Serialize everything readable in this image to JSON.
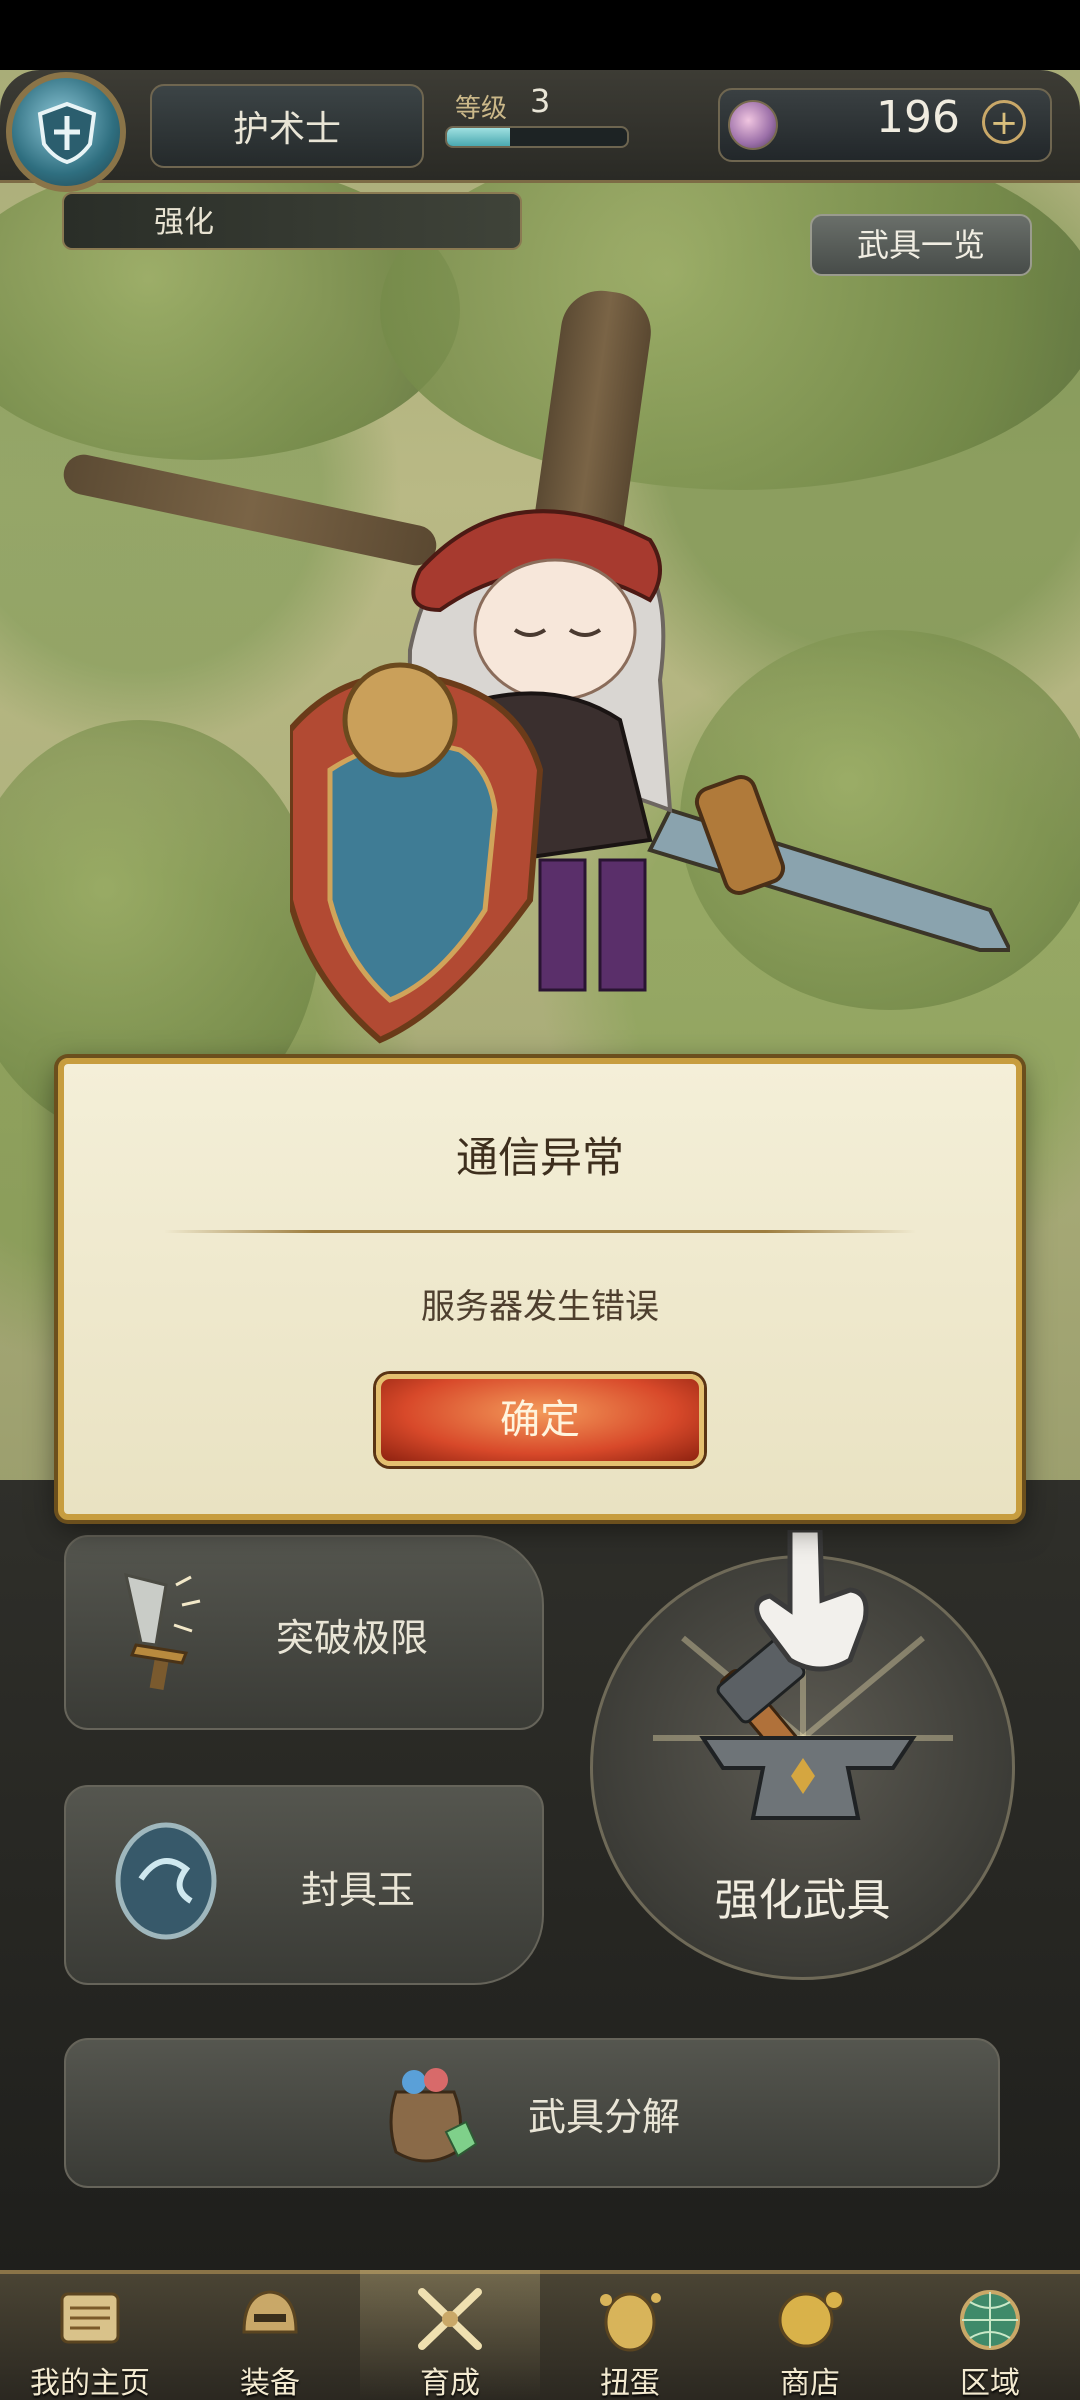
{
  "header": {
    "job_name": "护术士",
    "level_label": "等级",
    "level_value": "3",
    "level_progress": 0.35,
    "gem_count": "196",
    "plus_symbol": "+"
  },
  "sub_header": {
    "section": "强化",
    "weapon_list_label": "武具一览"
  },
  "dialog": {
    "title": "通信异常",
    "message": "服务器发生错误",
    "confirm_label": "确定"
  },
  "actions": {
    "limit_break": "突破极限",
    "seal_gem": "封具玉",
    "enhance_weapon": "强化武具",
    "dismantle": "武具分解"
  },
  "nav": {
    "items": [
      {
        "label": "我的主页",
        "icon": "scroll-icon"
      },
      {
        "label": "装备",
        "icon": "helmet-icon"
      },
      {
        "label": "育成",
        "icon": "crossed-swords-icon"
      },
      {
        "label": "扭蛋",
        "icon": "egg-gacha-icon"
      },
      {
        "label": "商店",
        "icon": "gold-coin-icon"
      },
      {
        "label": "区域",
        "icon": "globe-icon"
      }
    ],
    "active_index": 2
  },
  "colors": {
    "accent_gold": "#c79d3f",
    "confirm_red": "#d8492a",
    "level_fill": "#4aa8b0"
  }
}
